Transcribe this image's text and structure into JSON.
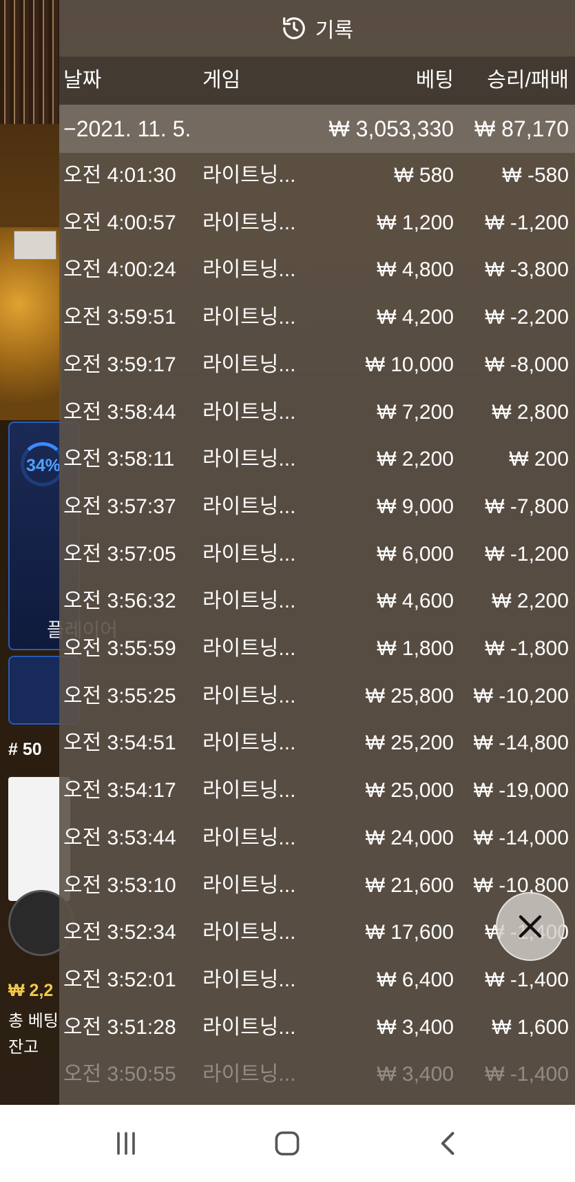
{
  "background": {
    "percent": "34%",
    "player_label": "플레이어",
    "round_number": "# 50",
    "balance_amount": "₩ 2,2",
    "total_bet_label": "총 베팅",
    "balance_label": "잔고"
  },
  "history": {
    "title": "기록",
    "columns": {
      "date": "날짜",
      "game": "게임",
      "bet": "베팅",
      "win_loss": "승리/패배"
    },
    "date_group": {
      "date": "−2021. 11. 5.",
      "bet_total": "₩ 3,053,330",
      "win_total": "₩ 87,170"
    },
    "rows": [
      {
        "time": "오전 4:01:30",
        "game": "라이트닝...",
        "bet": "₩ 580",
        "win": "₩ -580"
      },
      {
        "time": "오전 4:00:57",
        "game": "라이트닝...",
        "bet": "₩ 1,200",
        "win": "₩ -1,200"
      },
      {
        "time": "오전 4:00:24",
        "game": "라이트닝...",
        "bet": "₩ 4,800",
        "win": "₩ -3,800"
      },
      {
        "time": "오전 3:59:51",
        "game": "라이트닝...",
        "bet": "₩ 4,200",
        "win": "₩ -2,200"
      },
      {
        "time": "오전 3:59:17",
        "game": "라이트닝...",
        "bet": "₩ 10,000",
        "win": "₩ -8,000"
      },
      {
        "time": "오전 3:58:44",
        "game": "라이트닝...",
        "bet": "₩ 7,200",
        "win": "₩ 2,800"
      },
      {
        "time": "오전 3:58:11",
        "game": "라이트닝...",
        "bet": "₩ 2,200",
        "win": "₩ 200"
      },
      {
        "time": "오전 3:57:37",
        "game": "라이트닝...",
        "bet": "₩ 9,000",
        "win": "₩ -7,800"
      },
      {
        "time": "오전 3:57:05",
        "game": "라이트닝...",
        "bet": "₩ 6,000",
        "win": "₩ -1,200"
      },
      {
        "time": "오전 3:56:32",
        "game": "라이트닝...",
        "bet": "₩ 4,600",
        "win": "₩ 2,200"
      },
      {
        "time": "오전 3:55:59",
        "game": "라이트닝...",
        "bet": "₩ 1,800",
        "win": "₩ -1,800"
      },
      {
        "time": "오전 3:55:25",
        "game": "라이트닝...",
        "bet": "₩ 25,800",
        "win": "₩ -10,200"
      },
      {
        "time": "오전 3:54:51",
        "game": "라이트닝...",
        "bet": "₩ 25,200",
        "win": "₩ -14,800"
      },
      {
        "time": "오전 3:54:17",
        "game": "라이트닝...",
        "bet": "₩ 25,000",
        "win": "₩ -19,000"
      },
      {
        "time": "오전 3:53:44",
        "game": "라이트닝...",
        "bet": "₩ 24,000",
        "win": "₩ -14,000"
      },
      {
        "time": "오전 3:53:10",
        "game": "라이트닝...",
        "bet": "₩ 21,600",
        "win": "₩ -10,800"
      },
      {
        "time": "오전 3:52:34",
        "game": "라이트닝...",
        "bet": "₩ 17,600",
        "win": "₩ -1,400"
      },
      {
        "time": "오전 3:52:01",
        "game": "라이트닝...",
        "bet": "₩ 6,400",
        "win": "₩ -1,400"
      },
      {
        "time": "오전 3:51:28",
        "game": "라이트닝...",
        "bet": "₩ 3,400",
        "win": "₩ 1,600"
      },
      {
        "time": "오전 3:50:55",
        "game": "라이트닝...",
        "bet": "₩ 3,400",
        "win": "₩ -1,400"
      }
    ]
  },
  "icons": {
    "history": "history-icon",
    "close": "close-icon",
    "recents": "recents-icon",
    "home": "home-icon",
    "back": "back-icon"
  }
}
